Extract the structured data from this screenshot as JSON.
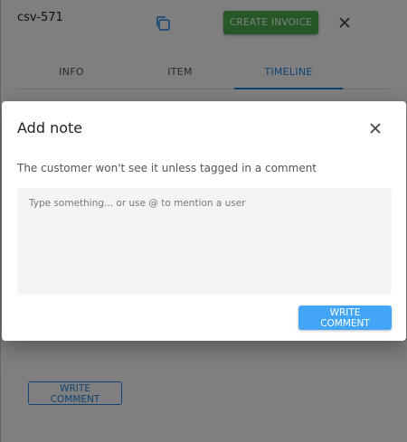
{
  "panel": {
    "order_id": "csv-571",
    "create_invoice_label": "CREATE INVOICE",
    "tabs": [
      {
        "label": "INFO"
      },
      {
        "label": "ITEM"
      },
      {
        "label": "TIMELINE"
      }
    ],
    "active_tab": "TIMELINE",
    "write_comment_label": "WRITE COMMENT"
  },
  "dialog": {
    "title": "Add note",
    "description": "The customer won't see it unless tagged in a comment",
    "input_value": "",
    "input_placeholder": "Type something... or use @ to mention a user",
    "submit_label": "WRITE COMMENT"
  },
  "colors": {
    "primary": "#1e88e5",
    "success": "#4caf50",
    "dialog_button": "#42a5f5"
  }
}
